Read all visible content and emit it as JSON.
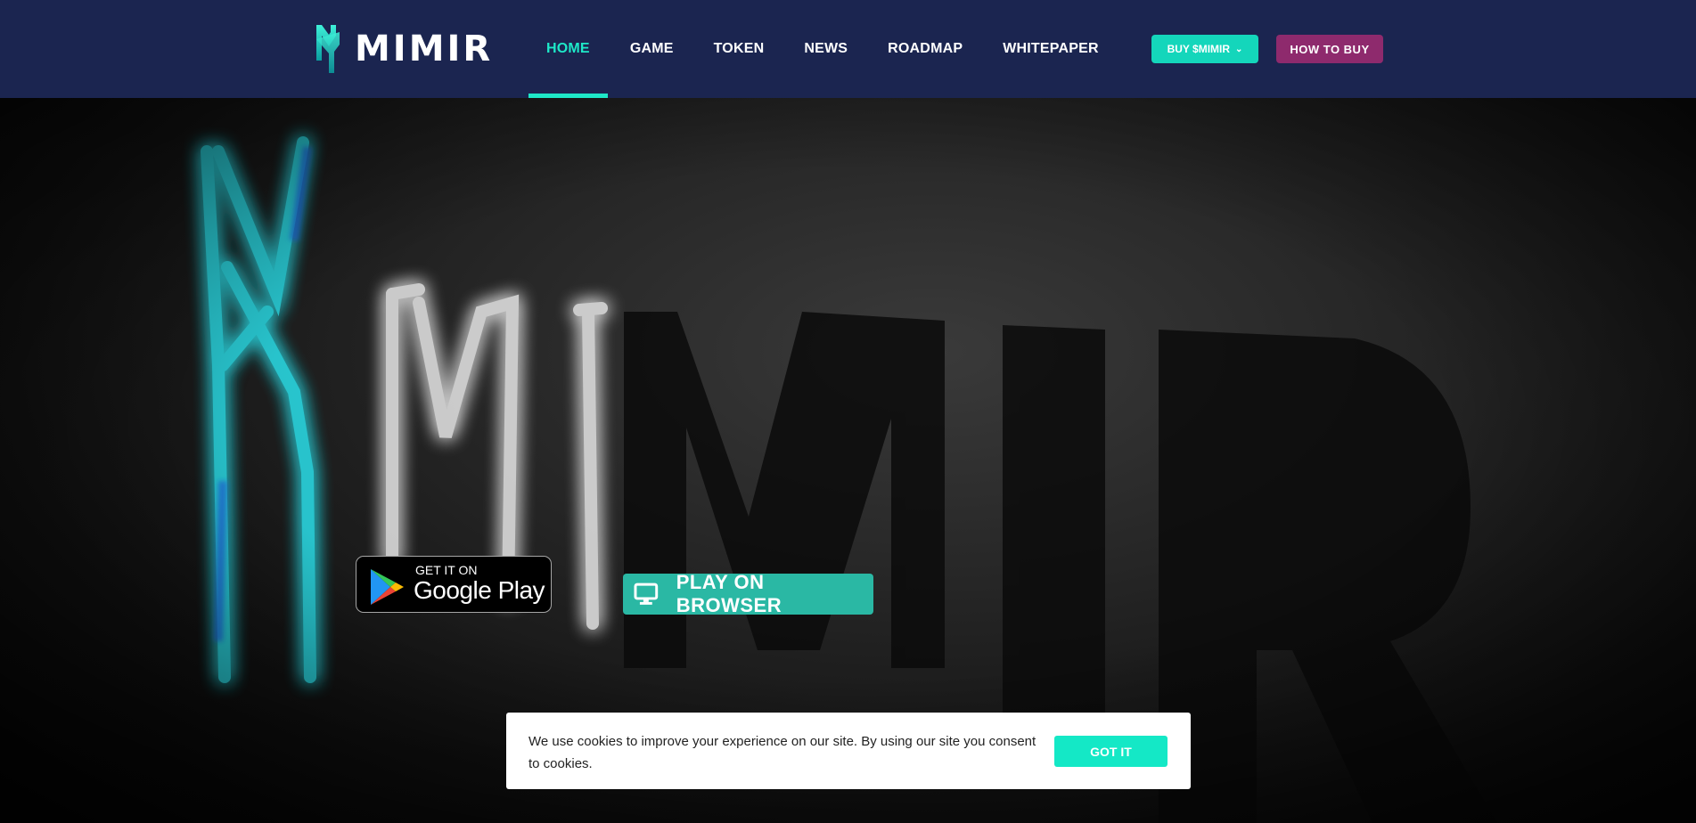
{
  "brand": {
    "name": "MIMIR",
    "accent_color": "#1ee8c8",
    "header_color": "#1b2550"
  },
  "nav": {
    "items": [
      {
        "label": "HOME",
        "active": true
      },
      {
        "label": "GAME",
        "active": false
      },
      {
        "label": "TOKEN",
        "active": false
      },
      {
        "label": "NEWS",
        "active": false
      },
      {
        "label": "ROADMAP",
        "active": false
      },
      {
        "label": "WHITEPAPER",
        "active": false
      }
    ]
  },
  "header_buttons": {
    "buy_label": "BUY $MIMIR",
    "buy_icon": "chevron-down-icon",
    "buy_color": "#14d6bb",
    "howto_label": "HOW TO BUY",
    "howto_color": "#8e2a6d"
  },
  "hero": {
    "google_play": {
      "small_text": "GET IT ON",
      "big_text": "Google Play",
      "icon": "google-play-icon"
    },
    "browser_button": {
      "label": "PLAY ON BROWSER",
      "icon": "monitor-icon",
      "color": "#2ab8a4"
    }
  },
  "cookie": {
    "text": "We use cookies to improve your experience on our site. By using our site you consent to cookies.",
    "button_label": "GOT IT",
    "button_color": "#14e8c6"
  }
}
